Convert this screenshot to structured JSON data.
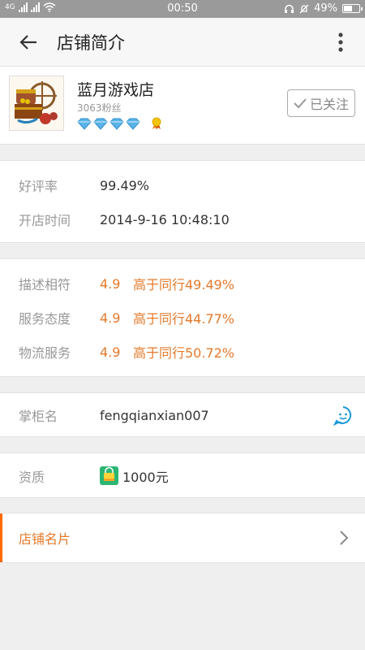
{
  "status_bar": {
    "network_label": "4G",
    "time": "00:50",
    "battery": "49%"
  },
  "header": {
    "title": "店铺简介"
  },
  "shop": {
    "name": "蓝月游戏店",
    "fans": "3063粉丝",
    "diamond_count": 4,
    "follow_label": "已关注"
  },
  "rating": {
    "label": "好评率",
    "value": "99.49%"
  },
  "open_time": {
    "label": "开店时间",
    "value": "2014-9-16 10:48:10"
  },
  "dsr": [
    {
      "label": "描述相符",
      "score": "4.9",
      "compare": "高于同行49.49%"
    },
    {
      "label": "服务态度",
      "score": "4.9",
      "compare": "高于同行44.77%"
    },
    {
      "label": "物流服务",
      "score": "4.9",
      "compare": "高于同行50.72%"
    }
  ],
  "owner": {
    "label": "掌柜名",
    "value": "fengqianxian007"
  },
  "qualification": {
    "label": "资质",
    "value": "1000元"
  },
  "shop_card": {
    "label": "店铺名片"
  },
  "colors": {
    "accent": "#e4792a",
    "brand_orange": "#ff6a00",
    "diamond": "#5ab4e8",
    "chat": "#1a9ad6",
    "deposit": "#2bb673"
  }
}
